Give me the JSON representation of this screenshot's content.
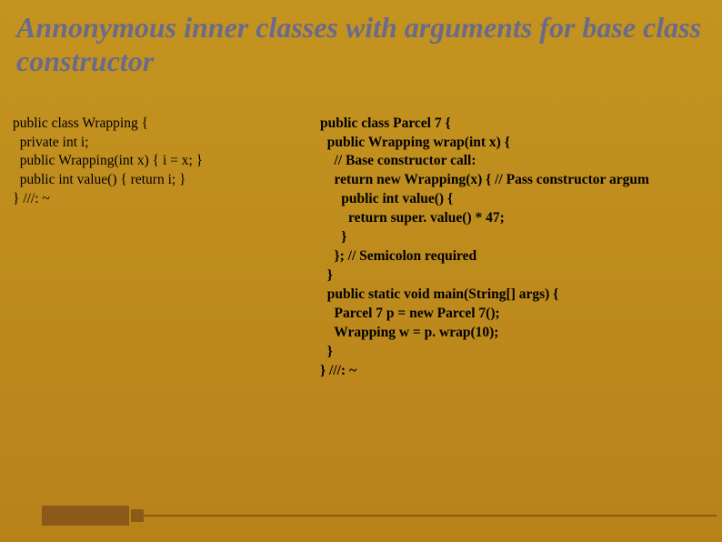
{
  "title": "Annonymous inner classes with arguments for base class constructor",
  "left": {
    "l0": "public class Wrapping {",
    "l1": "  private int i;",
    "l2": "  public Wrapping(int x) { i = x; }",
    "l3": "  public int value() { return i; }",
    "l4": "} ///: ~"
  },
  "right": {
    "l0": "public class Parcel 7 {",
    "l1": "  public Wrapping wrap(int x) {",
    "l2": "    // Base constructor call:",
    "l3": "    return new Wrapping(x) { // Pass constructor argum",
    "l4": "      public int value() {",
    "l5": "        return super. value() * 47;",
    "l6": "      }",
    "l7": "    }; // Semicolon required",
    "l8": "  }",
    "l9": "  public static void main(String[] args) {",
    "l10": "    Parcel 7 p = new Parcel 7();",
    "l11": "    Wrapping w = p. wrap(10);",
    "l12": "  }",
    "l13": "} ///: ~"
  }
}
